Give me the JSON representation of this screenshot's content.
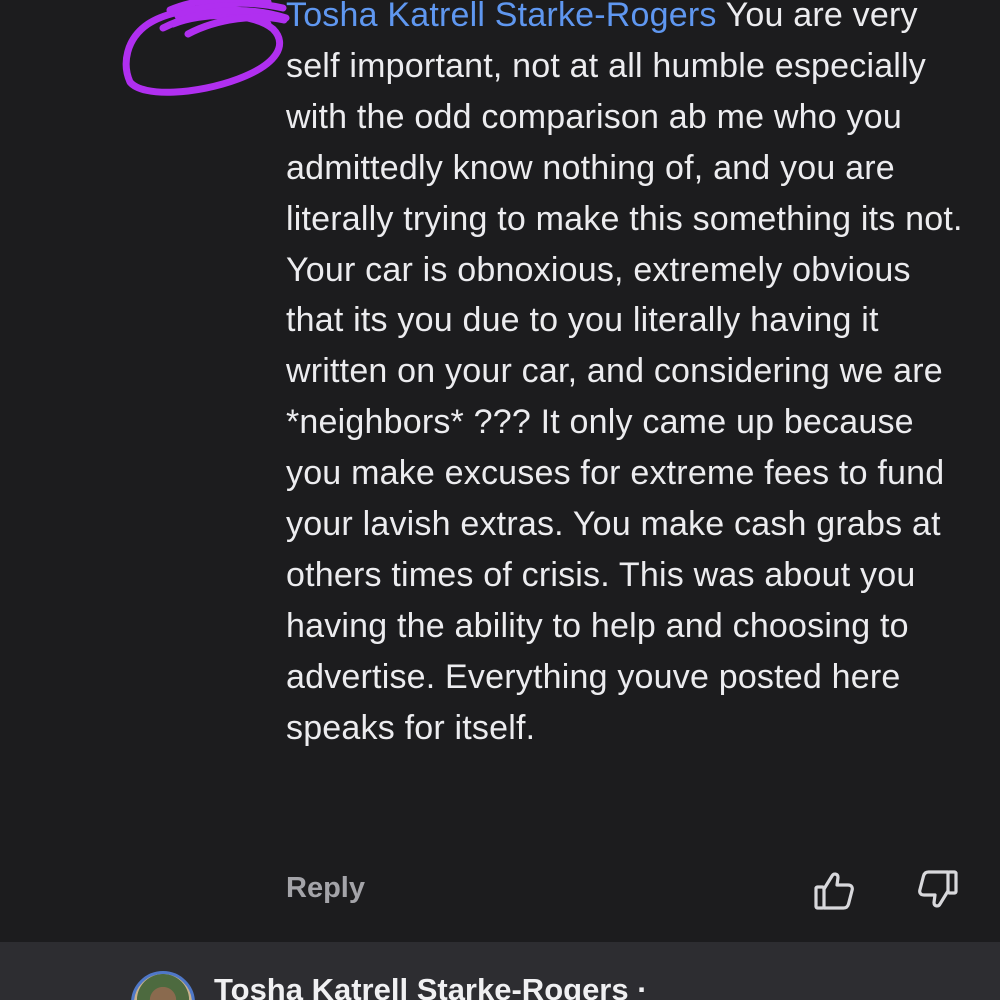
{
  "comment": {
    "author": "Tosha Katrell Starke-Rogers",
    "body": " You are very self important, not at all humble especially with the odd comparison ab me who you admittedly know nothing of, and you are literally trying to make this something its not. Your car is obnoxious, extremely obvious that its you due to you literally having it written on your car, and considering we are *neighbors* ??? It only came up because you make excuses for extreme fees to fund your lavish extras. You make cash grabs at others times of crisis. This was about you having the ability to help and choosing to advertise. Everything youve posted here speaks for itself.",
    "reply_label": "Reply",
    "upvote_icon": "thumbs-up-icon",
    "downvote_icon": "thumbs-down-icon"
  },
  "next_comment": {
    "author": "Tosha Katrell Starke-Rogers ·"
  },
  "colors": {
    "background": "#1c1c1e",
    "next_comment_background": "#2d2d31",
    "author_link": "#5f97f0",
    "body_text": "#ececef",
    "reply_text": "#a4a4a9",
    "scribble": "#b02ff0"
  }
}
